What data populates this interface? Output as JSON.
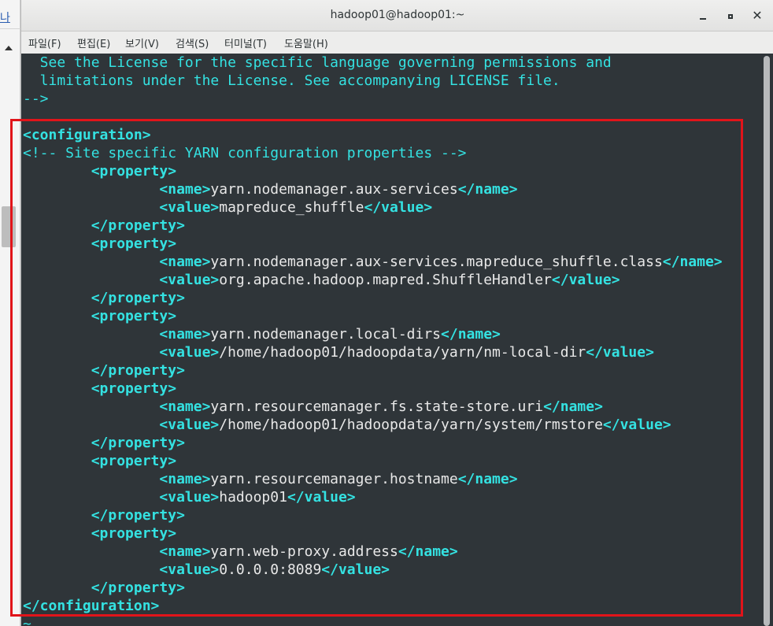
{
  "background": {
    "fragment": "나"
  },
  "window": {
    "title": "hadoop01@hadoop01:~",
    "min_label": "minimize",
    "max_label": "maximize",
    "close_label": "close"
  },
  "menu": {
    "items": [
      "파일(F)",
      "편집(E)",
      "보기(V)",
      "검색(S)",
      "터미널(T)",
      "도움말(H)"
    ]
  },
  "terminal": {
    "header": [
      "  See the License for the specific language governing permissions and",
      "  limitations under the License. See accompanying LICENSE file.",
      "-->",
      ""
    ],
    "config_open": "<configuration>",
    "comment": "<!-- Site specific YARN configuration properties -->",
    "properties": [
      {
        "name": "yarn.nodemanager.aux-services",
        "value": "mapreduce_shuffle"
      },
      {
        "name": "yarn.nodemanager.aux-services.mapreduce_shuffle.class",
        "value": "org.apache.hadoop.mapred.ShuffleHandler"
      },
      {
        "name": "yarn.nodemanager.local-dirs",
        "value": "/home/hadoop01/hadoopdata/yarn/nm-local-dir"
      },
      {
        "name": "yarn.resourcemanager.fs.state-store.uri",
        "value": "/home/hadoop01/hadoopdata/yarn/system/rmstore"
      },
      {
        "name": "yarn.resourcemanager.hostname",
        "value": "hadoop01"
      },
      {
        "name": "yarn.web-proxy.address",
        "value": "0.0.0.0:8089"
      }
    ],
    "config_close": "</configuration>",
    "tilde": "~"
  },
  "colors": {
    "terminal_bg": "#2f3539",
    "tag_cyan": "#34e2e2",
    "text": "#e8e8e8",
    "annotation_red": "#e1141a"
  }
}
